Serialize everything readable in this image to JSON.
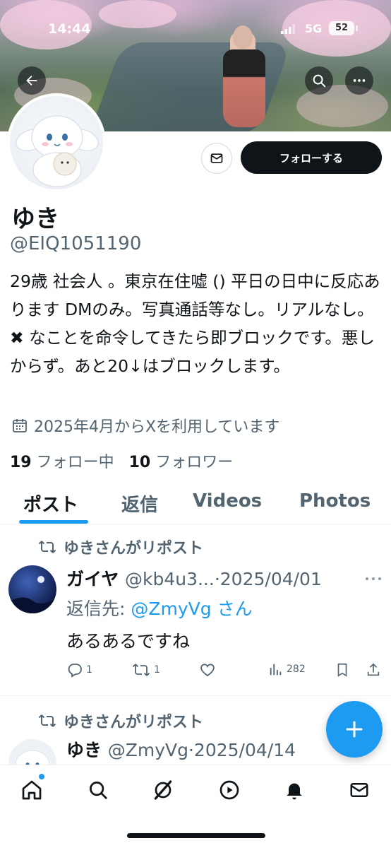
{
  "status_bar": {
    "time": "14:44",
    "network": "5G",
    "battery": "52"
  },
  "header": {
    "back_icon": "arrow-left-icon",
    "search_icon": "search-icon",
    "more_icon": "more-horizontal-icon"
  },
  "profile": {
    "follow_label": "フォローする",
    "name": "ゆき",
    "handle": "@EIQ1051190",
    "bio": "29歳 社会人 。東京在住嘘 () 平日の日中に反応あります DMのみ。写真通話等なし。リアルなし。 ✖ なことを命令してきたら即ブロックです。悪しからず。あと20↓はブロックします。",
    "joined": "2025年4月からXを利用しています",
    "following_count": "19",
    "following_label": "フォロー中",
    "followers_count": "10",
    "followers_label": "フォロワー"
  },
  "tabs": [
    "ポスト",
    "返信",
    "Videos",
    "Photos"
  ],
  "posts": [
    {
      "repost_label": "ゆきさんがリポスト",
      "author": "ガイヤ",
      "meta": "@kb4u3...·2025/04/01",
      "reply_prefix": "返信先: ",
      "reply_target": "@ZmyVg さん",
      "text": "あるあるですね",
      "replies": "1",
      "reposts": "1",
      "views": "282"
    },
    {
      "repost_label": "ゆきさんがリポスト",
      "author": "ゆき",
      "meta": "@ZmyVg·2025/04/14"
    }
  ],
  "colors": {
    "accent": "#1d9bf0",
    "text": "#0f1419",
    "muted": "#536471"
  }
}
